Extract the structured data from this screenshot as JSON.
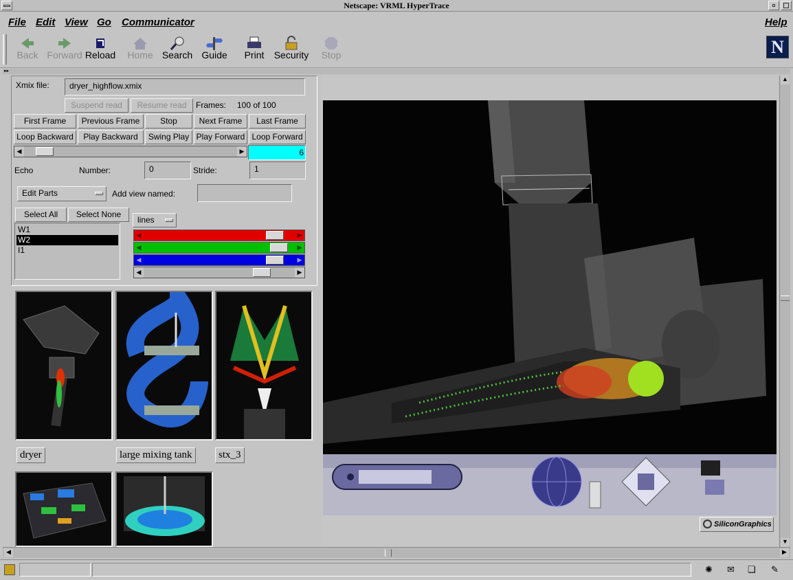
{
  "window": {
    "title": "Netscape: VRML HyperTrace"
  },
  "menu": {
    "file": "File",
    "edit": "Edit",
    "view": "View",
    "go": "Go",
    "communicator": "Communicator",
    "help": "Help"
  },
  "toolbar": {
    "back": "Back",
    "forward": "Forward",
    "reload": "Reload",
    "home": "Home",
    "search": "Search",
    "guide": "Guide",
    "print": "Print",
    "security": "Security",
    "stop": "Stop",
    "logo": "N"
  },
  "panel": {
    "xmix_label": "Xmix file:",
    "xmix_value": "dryer_highflow.xmix",
    "suspend_read": "Suspend read",
    "resume_read": "Resume read",
    "frames_label": "Frames:",
    "frames_value": "100 of 100",
    "first_frame": "First Frame",
    "previous_frame": "Previous Frame",
    "stop": "Stop",
    "next_frame": "Next Frame",
    "last_frame": "Last Frame",
    "loop_backward": "Loop Backward",
    "play_backward": "Play Backward",
    "swing_play": "Swing Play",
    "play_forward": "Play Forward",
    "loop_forward": "Loop Forward",
    "frame_counter": "6",
    "frame_slider_fraction": 0.06,
    "echo_label": "Echo",
    "number_label": "Number:",
    "number_value": "0",
    "stride_label": "Stride:",
    "stride_value": "1",
    "edit_parts": "Edit Parts",
    "add_view_label": "Add view named:",
    "add_view_value": "",
    "select_all": "Select All",
    "select_none": "Select None",
    "render_mode": "lines",
    "parts": [
      "W1",
      "W2",
      "I1"
    ],
    "selected_part": "W2",
    "color_levels": {
      "red": 0.92,
      "green": 0.95,
      "blue": 0.92,
      "gray": 0.82
    }
  },
  "thumbnails": {
    "labels": [
      "dryer",
      "large mixing tank",
      "stx_3"
    ]
  },
  "viewer": {
    "brand": "SiliconGraphics"
  },
  "colors": {
    "cyan": "#00ffff",
    "red": "#e00000",
    "green": "#00c000",
    "blue": "#0000e0"
  }
}
